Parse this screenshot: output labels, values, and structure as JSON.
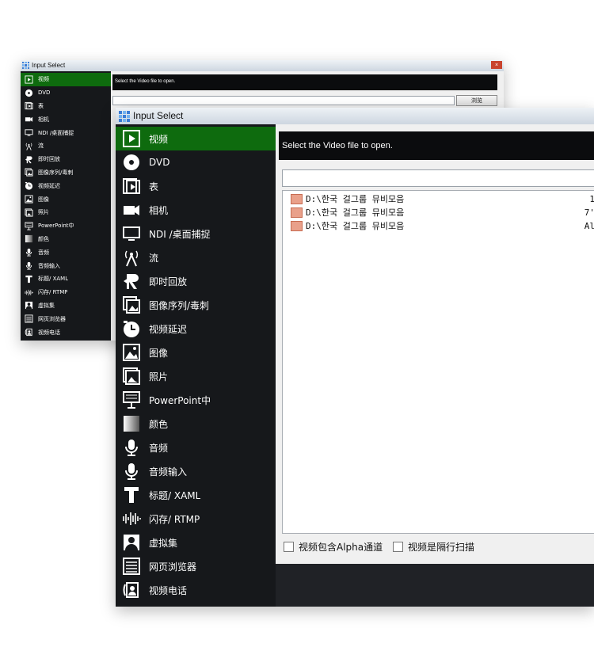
{
  "window": {
    "title": "Input Select",
    "close_label": "×"
  },
  "sidebar": {
    "items": [
      {
        "label": "视频",
        "icon": "video-icon"
      },
      {
        "label": "DVD",
        "icon": "disc-icon"
      },
      {
        "label": "表",
        "icon": "list-icon"
      },
      {
        "label": "相机",
        "icon": "camera-icon"
      },
      {
        "label": "NDI /桌面捕捉",
        "icon": "monitor-icon"
      },
      {
        "label": "流",
        "icon": "antenna-icon"
      },
      {
        "label": "即时回放",
        "icon": "replay-icon"
      },
      {
        "label": "图像序列/毒刺",
        "icon": "image-sequence-icon"
      },
      {
        "label": "视频延迟",
        "icon": "clock-icon"
      },
      {
        "label": "图像",
        "icon": "image-icon"
      },
      {
        "label": "照片",
        "icon": "photos-icon"
      },
      {
        "label": "PowerPoint中",
        "icon": "presentation-icon"
      },
      {
        "label": "颜色",
        "icon": "color-icon"
      },
      {
        "label": "音频",
        "icon": "microphone-icon"
      },
      {
        "label": "音频输入",
        "icon": "microphone-input-icon"
      },
      {
        "label": "标题/ XAML",
        "icon": "title-icon"
      },
      {
        "label": "闪存/ RTMP",
        "icon": "waveform-icon"
      },
      {
        "label": "虚拟集",
        "icon": "virtual-set-icon"
      },
      {
        "label": "网页浏览器",
        "icon": "browser-icon"
      },
      {
        "label": "视频电话",
        "icon": "video-call-icon"
      }
    ],
    "selected_index": 0
  },
  "panel": {
    "hint": "Select the Video file to open.",
    "path_value": "",
    "browse_label": "浏览",
    "files": [
      {
        "icon": "video-file-icon",
        "name": "D:\\한국 걸그룹 뮤비모음",
        "size": "1"
      },
      {
        "icon": "video-file-icon",
        "name": "D:\\한국 걸그룹 뮤비모음",
        "size": "7'"
      },
      {
        "icon": "video-file-icon",
        "name": "D:\\한국 걸그룹 뮤비모음",
        "size": "Al"
      }
    ],
    "checkboxes": [
      {
        "label": "视频包含Alpha通道",
        "checked": false
      },
      {
        "label": "视频是隔行扫描",
        "checked": false
      }
    ]
  },
  "colors": {
    "selected": "#0e6b0e",
    "background": "#16181b",
    "titlebar": "#dfe6ee"
  }
}
